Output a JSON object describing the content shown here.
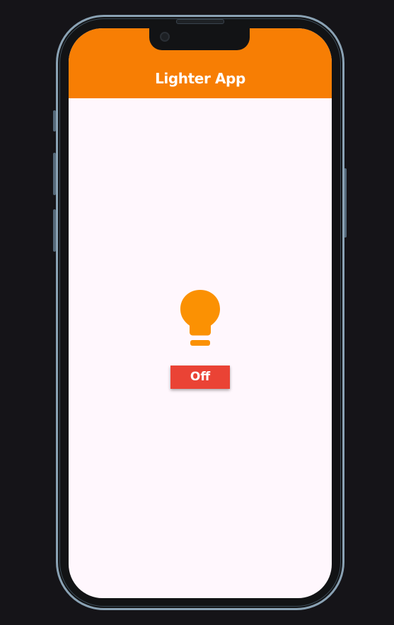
{
  "app": {
    "title": "Lighter App"
  },
  "light": {
    "icon": "lightbulb-icon",
    "color": "#fb9103"
  },
  "toggle": {
    "label": "Off",
    "color": "#ea4335"
  },
  "theme": {
    "app_bar_color": "#f77e04",
    "screen_background": "#fff7fd"
  }
}
